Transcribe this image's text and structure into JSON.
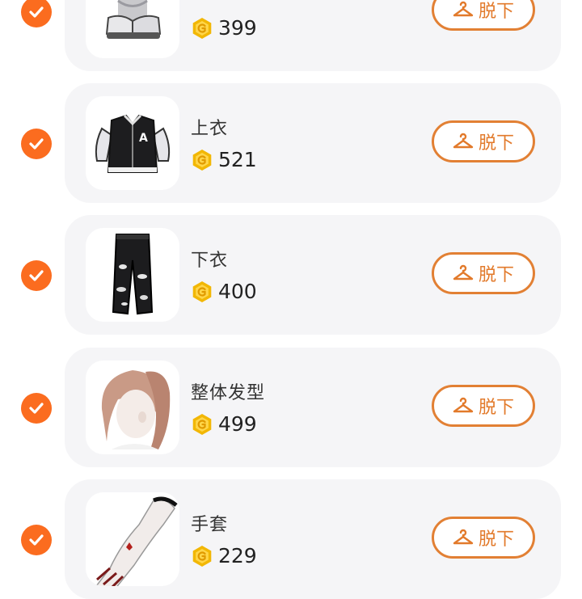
{
  "colors": {
    "accent": "#fb6c1f",
    "button_border": "#e28034",
    "coin": "#f2b705",
    "card_bg": "#f5f5f7"
  },
  "unequip_icon": "hanger-icon",
  "coin_icon": "coin-icon",
  "items": [
    {
      "name": "",
      "price": "399",
      "selected": true,
      "button_label": "脱下",
      "thumb": "shoes-image"
    },
    {
      "name": "上衣",
      "price": "521",
      "selected": true,
      "button_label": "脱下",
      "thumb": "varsity-jacket-image"
    },
    {
      "name": "下衣",
      "price": "400",
      "selected": true,
      "button_label": "脱下",
      "thumb": "ripped-jeans-image"
    },
    {
      "name": "整体发型",
      "price": "499",
      "selected": true,
      "button_label": "脱下",
      "thumb": "ponytail-hair-image"
    },
    {
      "name": "手套",
      "price": "229",
      "selected": true,
      "button_label": "脱下",
      "thumb": "gloves-image"
    }
  ]
}
